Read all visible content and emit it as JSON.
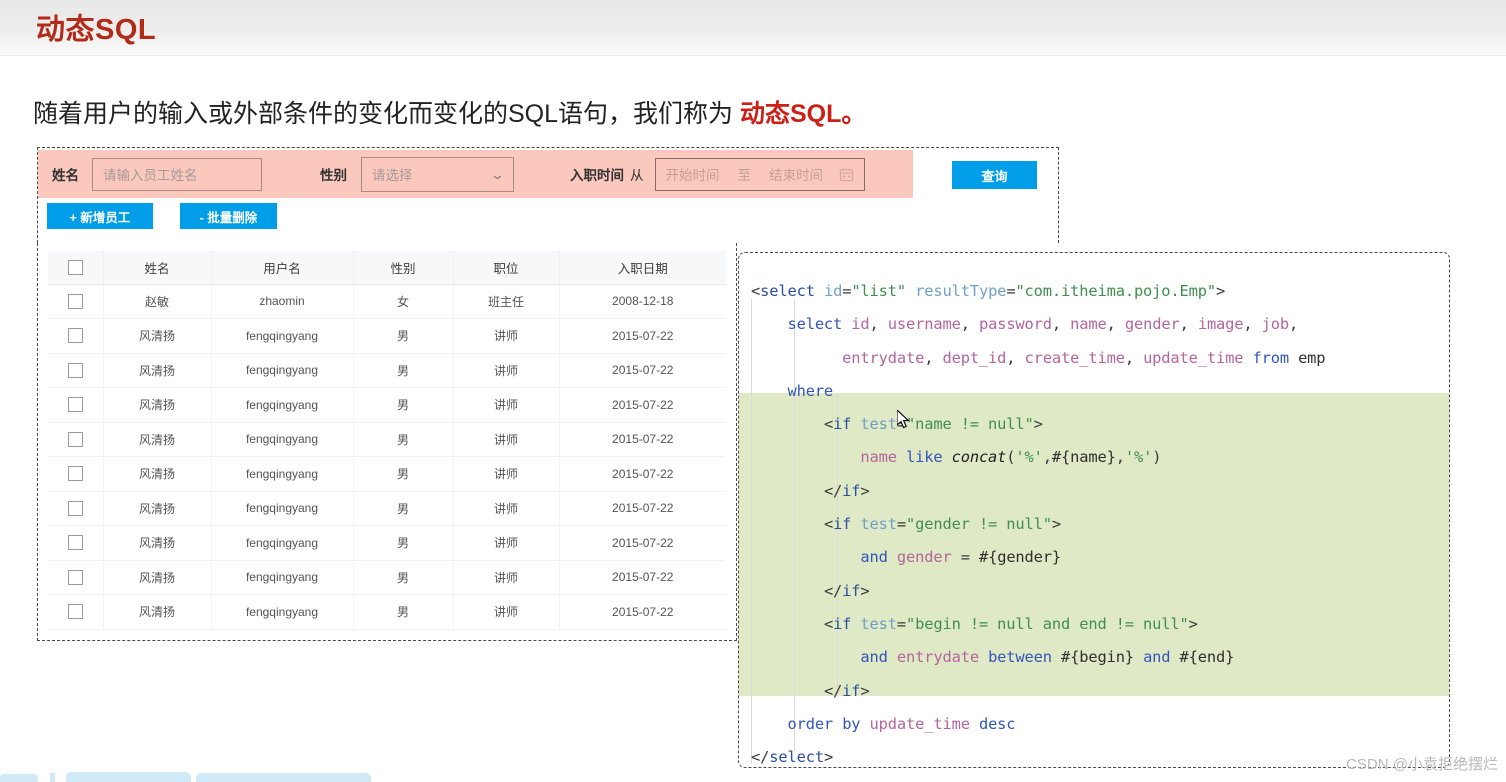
{
  "header": {
    "title": "动态SQL"
  },
  "subtitle": {
    "lead": "随着用户的输入或外部条件的变化而变化的SQL语句，我们称为 ",
    "emphasis": "动态SQL",
    "period": "。"
  },
  "search_form": {
    "name_label": "姓名",
    "name_placeholder": "请输入员工姓名",
    "gender_label": "性别",
    "gender_placeholder": "请选择",
    "gender_chevron": "chevron-down-icon",
    "date_label": "入职时间",
    "date_from_word": "从",
    "date_start_placeholder": "开始时间",
    "date_sep": "至",
    "date_end_placeholder": "结束时间",
    "calendar_icon": "calendar-icon",
    "query_button": "查询"
  },
  "toolbar": {
    "add_button": "+ 新增员工",
    "delete_button": "- 批量删除"
  },
  "table": {
    "headers": [
      "",
      "姓名",
      "用户名",
      "性别",
      "职位",
      "入职日期"
    ],
    "rows": [
      {
        "name": "赵敏",
        "username": "zhaomin",
        "gender": "女",
        "job": "班主任",
        "date": "2008-12-18"
      },
      {
        "name": "风清扬",
        "username": "fengqingyang",
        "gender": "男",
        "job": "讲师",
        "date": "2015-07-22"
      },
      {
        "name": "风清扬",
        "username": "fengqingyang",
        "gender": "男",
        "job": "讲师",
        "date": "2015-07-22"
      },
      {
        "name": "风清扬",
        "username": "fengqingyang",
        "gender": "男",
        "job": "讲师",
        "date": "2015-07-22"
      },
      {
        "name": "风清扬",
        "username": "fengqingyang",
        "gender": "男",
        "job": "讲师",
        "date": "2015-07-22"
      },
      {
        "name": "风清扬",
        "username": "fengqingyang",
        "gender": "男",
        "job": "讲师",
        "date": "2015-07-22"
      },
      {
        "name": "风清扬",
        "username": "fengqingyang",
        "gender": "男",
        "job": "讲师",
        "date": "2015-07-22"
      },
      {
        "name": "风清扬",
        "username": "fengqingyang",
        "gender": "男",
        "job": "讲师",
        "date": "2015-07-22"
      },
      {
        "name": "风清扬",
        "username": "fengqingyang",
        "gender": "男",
        "job": "讲师",
        "date": "2015-07-22"
      },
      {
        "name": "风清扬",
        "username": "fengqingyang",
        "gender": "男",
        "job": "讲师",
        "date": "2015-07-22"
      }
    ]
  },
  "code": {
    "language": "mybatis-xml",
    "highlight_color": "#dfe9c5",
    "lines": [
      "<select id=\"list\" resultType=\"com.itheima.pojo.Emp\">",
      "    select id, username, password, name, gender, image, job,",
      "          entrydate, dept_id, create_time, update_time from emp",
      "    where",
      "        <if test=\"name != null\">",
      "            name like concat('%',#{name},'%')",
      "        </if>",
      "        <if test=\"gender != null\">",
      "            and gender = #{gender}",
      "        </if>",
      "        <if test=\"begin != null and end != null\">",
      "            and entrydate between #{begin} and #{end}",
      "        </if>",
      "    order by update_time desc",
      "</select>"
    ],
    "highlighted_lines": [
      4,
      5,
      6,
      7,
      8,
      9,
      10,
      11,
      12
    ]
  },
  "watermark": {
    "text": "CSDN @小袁拒绝摆烂"
  },
  "colors": {
    "title_red": "#b22a18",
    "accent_blue": "#009ee8",
    "search_strip_pink": "#fbc8bd",
    "code_highlight_green": "#dfe9c5"
  }
}
